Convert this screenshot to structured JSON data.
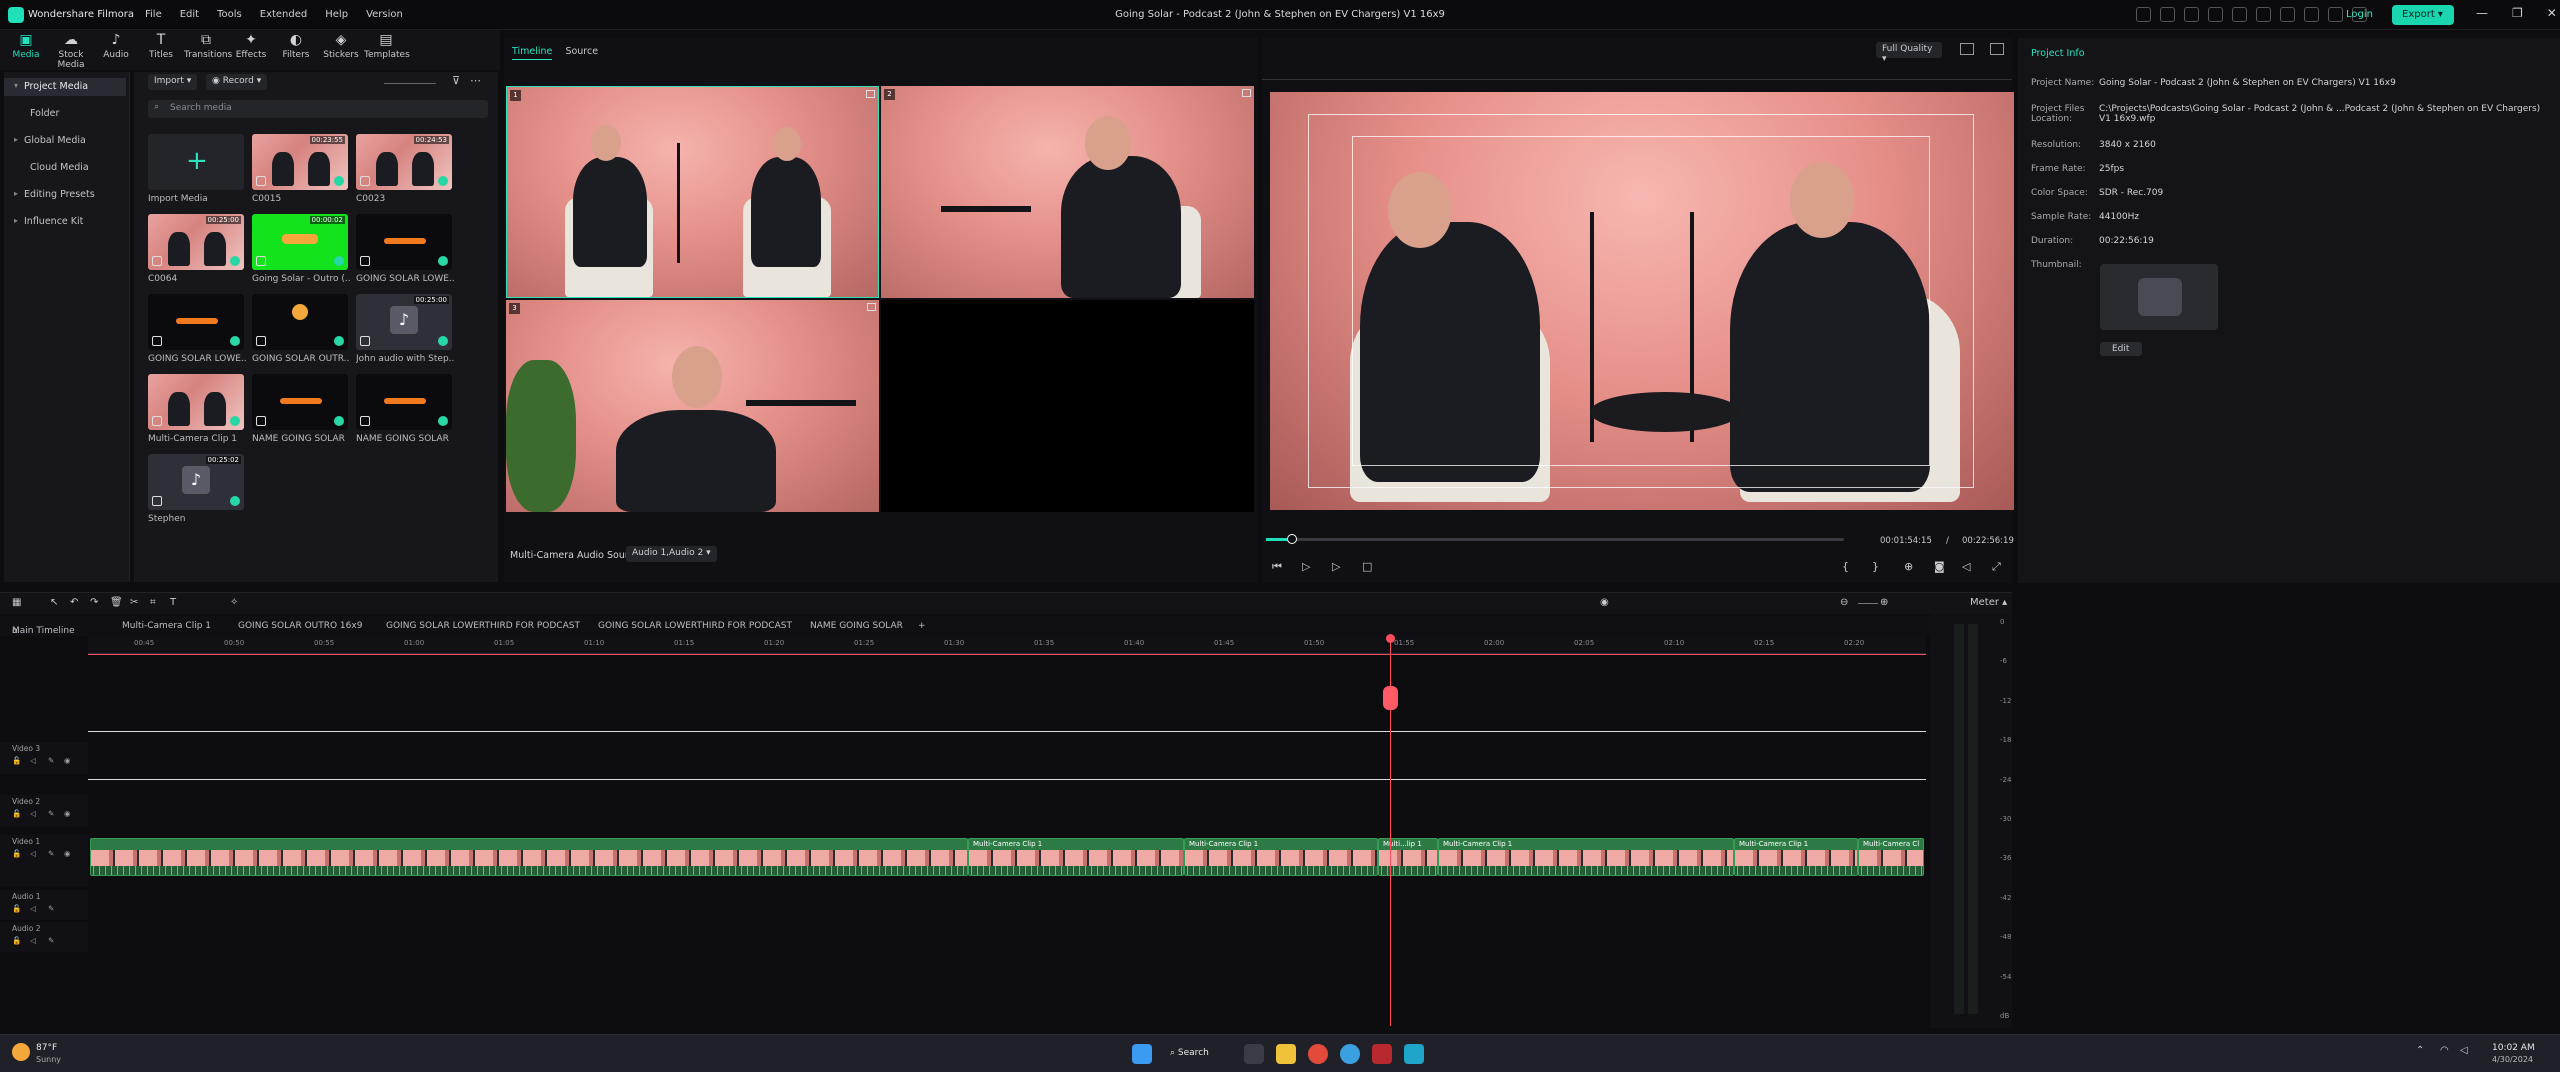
{
  "app": {
    "name": "Wondershare Filmora",
    "menu": [
      "File",
      "Edit",
      "Tools",
      "Extended",
      "Help",
      "Version"
    ],
    "title": "Going Solar - Podcast 2 (John & Stephen on EV Chargers) V1 16x9",
    "login": "Login",
    "export": "Export"
  },
  "toolbar": [
    {
      "label": "Media",
      "icon": "media-icon",
      "glyph": "▣",
      "active": true
    },
    {
      "label": "Stock Media",
      "icon": "stock-media-icon",
      "glyph": "☁"
    },
    {
      "label": "Audio",
      "icon": "audio-icon",
      "glyph": "♪"
    },
    {
      "label": "Titles",
      "icon": "titles-icon",
      "glyph": "T"
    },
    {
      "label": "Transitions",
      "icon": "transitions-icon",
      "glyph": "⧉"
    },
    {
      "label": "Effects",
      "icon": "effects-icon",
      "glyph": "✦"
    },
    {
      "label": "Filters",
      "icon": "filters-icon",
      "glyph": "◐"
    },
    {
      "label": "Stickers",
      "icon": "stickers-icon",
      "glyph": "◈"
    },
    {
      "label": "Templates",
      "icon": "templates-icon",
      "glyph": "▤"
    }
  ],
  "sidebar": [
    "Project Media",
    "Folder",
    "Global Media",
    "Cloud Media",
    "Editing Presets",
    "Influence Kit"
  ],
  "media": {
    "import_label": "Import",
    "record_label": "Record",
    "search_placeholder": "Search media",
    "items": [
      {
        "label": "Import Media",
        "thumb": "import",
        "duration": ""
      },
      {
        "label": "C0015",
        "thumb": "room",
        "duration": "00:23:55"
      },
      {
        "label": "C0023",
        "thumb": "room",
        "duration": "00:24:53"
      },
      {
        "label": "C0064",
        "thumb": "room",
        "duration": "00:25:00"
      },
      {
        "label": "Going Solar - Outro (...",
        "thumb": "green",
        "duration": "00:00:02"
      },
      {
        "label": "GOING SOLAR LOWE...",
        "thumb": "lower",
        "duration": ""
      },
      {
        "label": "GOING SOLAR LOWE...",
        "thumb": "lower",
        "duration": ""
      },
      {
        "label": "GOING SOLAR OUTR...",
        "thumb": "outro",
        "duration": ""
      },
      {
        "label": "John audio with Step...",
        "thumb": "audio",
        "duration": "00:25:00"
      },
      {
        "label": "Multi-Camera Clip 1",
        "thumb": "room",
        "duration": ""
      },
      {
        "label": "NAME GOING SOLAR",
        "thumb": "lower",
        "duration": ""
      },
      {
        "label": "NAME GOING SOLAR",
        "thumb": "lower",
        "duration": ""
      },
      {
        "label": "Stephen",
        "thumb": "audio",
        "duration": "00:25:02"
      }
    ]
  },
  "multicam": {
    "tab_timeline": "Timeline",
    "tab_source": "Source",
    "audio_source_label": "Multi-Camera Audio Source",
    "audio_source_value": "Audio 1,Audio 2",
    "cams": [
      "1",
      "2",
      "3"
    ]
  },
  "preview": {
    "quality": "Full Quality",
    "current_time": "00:01:54:15",
    "separator": "/",
    "total_time": "00:22:56:19",
    "progress": 0.045
  },
  "project_info": {
    "heading": "Project Info",
    "rows": [
      {
        "k": "Project Name:",
        "v": "Going Solar - Podcast 2 (John & Stephen on EV Chargers) V1 16x9"
      },
      {
        "k": "Project Files Location:",
        "v": "C:\\Projects\\Podcasts\\Going Solar - Podcast 2 (John & ...Podcast 2 (John & Stephen on EV Chargers) V1 16x9.wfp"
      },
      {
        "k": "Resolution:",
        "v": "3840 x 2160"
      },
      {
        "k": "Frame Rate:",
        "v": "25fps"
      },
      {
        "k": "Color Space:",
        "v": "SDR - Rec.709"
      },
      {
        "k": "Sample Rate:",
        "v": "44100Hz"
      },
      {
        "k": "Duration:",
        "v": "00:22:56:19"
      },
      {
        "k": "Thumbnail:",
        "v": ""
      }
    ],
    "edit": "Edit"
  },
  "timeline": {
    "tabs": [
      "Main Timeline",
      "Multi-Camera Clip 1",
      "GOING SOLAR OUTRO 16x9",
      "GOING SOLAR LOWERTHIRD FOR PODCAST",
      "GOING SOLAR LOWERTHIRD FOR PODCAST",
      "NAME GOING SOLAR"
    ],
    "meter_label": "Meter",
    "ruler": [
      "00:45",
      "00:50",
      "00:55",
      "01:00",
      "01:05",
      "01:10",
      "01:15",
      "01:20",
      "01:25",
      "01:30",
      "01:35",
      "01:40",
      "01:45",
      "01:50",
      "01:55",
      "02:00",
      "02:05",
      "02:10",
      "02:15",
      "02:20"
    ],
    "tracks": [
      "Video 3",
      "Video 2",
      "Video 1",
      "Audio 1",
      "Audio 2"
    ],
    "clips": [
      "Multi-Camera Clip 1",
      "Multi-Camera Clip 1",
      "Multi...lip 1",
      "Multi-Camera Clip 1",
      "Multi-Camera Clip 1",
      "Multi-Camera Cl"
    ],
    "meter_ticks": [
      "0",
      "-6",
      "-12",
      "-18",
      "-24",
      "-30",
      "-36",
      "-42",
      "-48",
      "-54",
      "dB"
    ]
  },
  "taskbar": {
    "temp": "87°F",
    "weather": "Sunny",
    "search": "Search",
    "time": "10:02 AM",
    "date": "4/30/2024"
  }
}
